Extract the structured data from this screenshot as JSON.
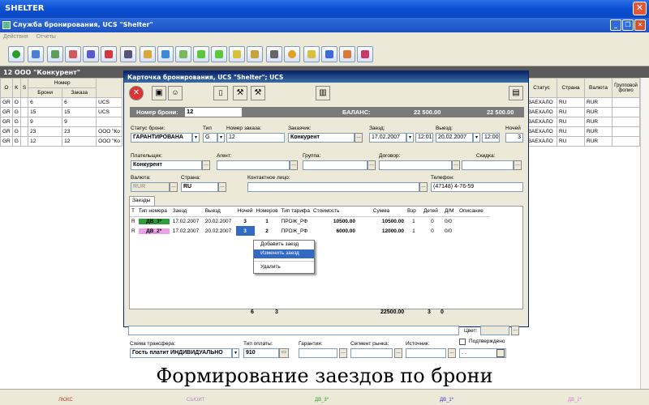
{
  "outer": {
    "title": "SHELTER"
  },
  "app": {
    "title": "Служба бронирования, UCS \"Shelter\""
  },
  "menu": [
    "Действия",
    "Отчеты"
  ],
  "list": {
    "header": "12  ООО \"Конкурент\"",
    "columns": {
      "o": "O",
      "k": "K",
      "s": "S",
      "number": "Номер",
      "broni": "Брони",
      "zakaza": "Заказа"
    },
    "rows": [
      {
        "o": "GR",
        "k": "O",
        "broni": "6",
        "zakaza": "6",
        "agent": "UCS"
      },
      {
        "o": "GR",
        "k": "G",
        "broni": "15",
        "zakaza": "15",
        "agent": "UCS"
      },
      {
        "o": "GR",
        "k": "G",
        "broni": "9",
        "zakaza": "9",
        "agent": ""
      },
      {
        "o": "GR",
        "k": "G",
        "broni": "23",
        "zakaza": "23",
        "agent": "ООО \"Ко"
      },
      {
        "o": "GR",
        "k": "G",
        "broni": "12",
        "zakaza": "12",
        "agent": "ООО \"Ко"
      }
    ],
    "right_columns": {
      "status": "Статус",
      "country": "Страна",
      "currency": "Валюта",
      "group": "Групповой фолио"
    },
    "right_rows": [
      {
        "status": "ЗАЕХАЛО",
        "country": "RU",
        "currency": "RUR"
      },
      {
        "status": "ЗАЕХАЛО",
        "country": "RU",
        "currency": "RUR"
      },
      {
        "status": "ЗАЕХАЛО",
        "country": "RU",
        "currency": "RUR"
      },
      {
        "status": "ЗАЕХАЛО",
        "country": "RU",
        "currency": "RUR"
      },
      {
        "status": "ЗАЕХАЛО",
        "country": "RU",
        "currency": "RUR"
      }
    ]
  },
  "modal": {
    "title": "Карточка бронирования, UCS \"Shelter\"; UCS",
    "booking_no_label": "Номер брони:",
    "booking_no": "12",
    "balance_label": "БАЛАНС:",
    "balance1": "22 500.00",
    "balance2": "22 500.00",
    "labels": {
      "status": "Статус брони:",
      "type": "Тип",
      "order_no": "Номер заказа:",
      "customer": "Заказчик:",
      "checkin": "Заезд:",
      "checkout": "Выезд:",
      "nights": "Ночей",
      "payer": "Плательщик:",
      "agent": "Агент:",
      "group": "Группа:",
      "contract": "Договор:",
      "discount": "Скидка:",
      "currency": "Валюта:",
      "country": "Страна:",
      "contact": "Контактное лицо:",
      "phone": "Телефон:",
      "color": "Цвет:",
      "confirmed": "Подтверждено",
      "transfer": "Схема трансфера:",
      "pay_type": "Тип оплаты:",
      "guarantee": "Гарантия:",
      "segment": "Сегмент рынка:",
      "source": "Источник:"
    },
    "values": {
      "status": "ГАРАНТИРОВАНА",
      "type": "G",
      "order_no": "12",
      "customer": "Конкурент",
      "checkin_date": "17.02.2007",
      "checkin_time": "12:01",
      "checkout_date": "20.02.2007",
      "checkout_time": "12:00",
      "nights": "3",
      "payer": "Конкурент",
      "currency": "RUR",
      "country": "RU",
      "phone": "(47148) 4-76-59",
      "transfer": "Гость платит ИНДИВИДУАЛЬНО",
      "pay_type": "910",
      "source_value": ". ."
    },
    "tab": "Заезды",
    "stay_columns": [
      "Т",
      "Тип номера",
      "Заезд",
      "Выезд",
      "Ночей",
      "Номеров",
      "Тип тарифа",
      "Стоимость",
      "Сумма",
      "Взр",
      "Детей",
      "Д/М",
      "Описание"
    ],
    "stays": [
      {
        "t": "R",
        "room": "ДВ_3*",
        "in": "17.02.2007",
        "out": "20.02.2007",
        "nights": "3",
        "rooms": "1",
        "tariff": "ПРОЖ_РФ",
        "cost": "10500.00",
        "sum": "10500.00",
        "adults": "1",
        "kids": "0",
        "dm": "0/0",
        "color": "#2e9e3a"
      },
      {
        "t": "R",
        "room": "ДВ_2*",
        "in": "17.02.2007",
        "out": "20.02.2007",
        "nights": "3",
        "rooms": "2",
        "tariff": "ПРОЖ_РФ",
        "cost": "6000.00",
        "sum": "12000.00",
        "adults": "1",
        "kids": "0",
        "dm": "0/0",
        "color": "#e8a2e8"
      }
    ],
    "totals": {
      "nights": "6",
      "rooms": "3",
      "sum": "22500.00",
      "adults": "3",
      "kids": "0"
    },
    "context_menu": [
      "Добавить заезд",
      "Изменить заезд",
      "Удалить"
    ]
  },
  "caption": "Формирование заездов по брони",
  "status_tabs": [
    "ЛЮКС",
    "СЬЮИТ",
    "ДВ_3*",
    "ДВ_1*",
    "ДВ_2*"
  ]
}
